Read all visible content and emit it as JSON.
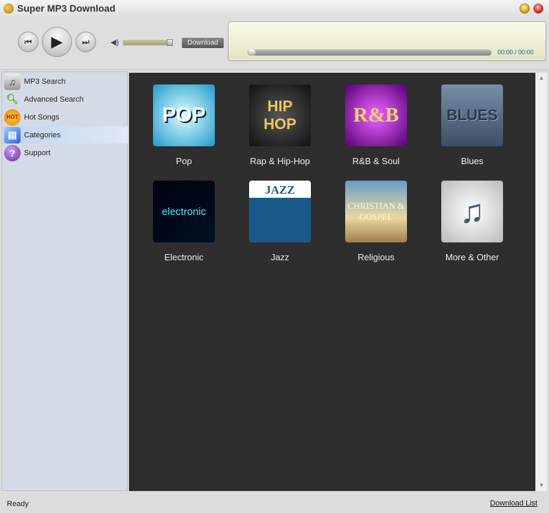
{
  "window": {
    "title": "Super MP3 Download"
  },
  "player": {
    "download_label": "Download",
    "time": "00:00 / 00:00",
    "volume_percent": 90,
    "progress_percent": 0
  },
  "sidebar": {
    "items": [
      {
        "label": "MP3 Search",
        "icon": "music-note-icon"
      },
      {
        "label": "Advanced Search",
        "icon": "magnifier-icon"
      },
      {
        "label": "Hot Songs",
        "icon": "hot-sun-icon"
      },
      {
        "label": "Categories",
        "icon": "categories-icon",
        "selected": true
      },
      {
        "label": "Support",
        "icon": "question-icon"
      }
    ]
  },
  "categories": [
    {
      "label": "Pop",
      "art_text": "POP"
    },
    {
      "label": "Rap & Hip-Hop",
      "art_text": "HIP HOP"
    },
    {
      "label": "R&B & Soul",
      "art_text": "R&B"
    },
    {
      "label": "Blues",
      "art_text": "BLUES"
    },
    {
      "label": "Electronic",
      "art_text": "electronic"
    },
    {
      "label": "Jazz",
      "art_text": "JAZZ"
    },
    {
      "label": "Religious",
      "art_text": "CHRISTIAN & GOSPEL"
    },
    {
      "label": "More & Other",
      "art_text": "♫"
    }
  ],
  "status": {
    "text": "Ready",
    "download_list": "Download List"
  }
}
